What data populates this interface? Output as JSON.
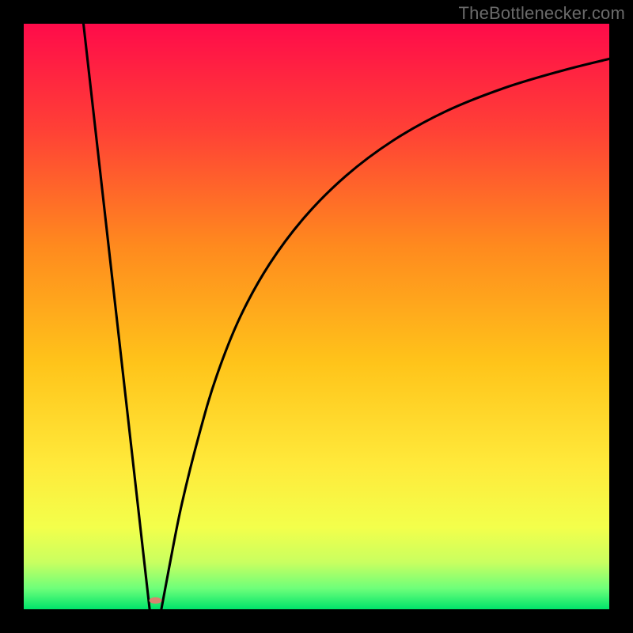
{
  "watermark": "TheBottlenecker.com",
  "chart_data": {
    "type": "line",
    "title": "",
    "xlabel": "",
    "ylabel": "",
    "xlim": [
      0,
      100
    ],
    "ylim": [
      0,
      100
    ],
    "notch_x": 22,
    "marker": {
      "x": 22.5,
      "y": 1.5,
      "rx": 8,
      "ry": 4,
      "fill": "#d8846f"
    },
    "series": [
      {
        "name": "left-branch",
        "points": [
          {
            "x": 10.2,
            "y": 100
          },
          {
            "x": 21.5,
            "y": 0
          }
        ]
      },
      {
        "name": "right-branch",
        "points": [
          {
            "x": 23.5,
            "y": 0
          },
          {
            "x": 25,
            "y": 8
          },
          {
            "x": 27,
            "y": 18
          },
          {
            "x": 30,
            "y": 30
          },
          {
            "x": 33,
            "y": 40
          },
          {
            "x": 37,
            "y": 50
          },
          {
            "x": 42,
            "y": 59
          },
          {
            "x": 48,
            "y": 67
          },
          {
            "x": 55,
            "y": 74
          },
          {
            "x": 63,
            "y": 80
          },
          {
            "x": 72,
            "y": 85
          },
          {
            "x": 82,
            "y": 89
          },
          {
            "x": 92,
            "y": 92
          },
          {
            "x": 100,
            "y": 94
          }
        ]
      }
    ],
    "gradient_stops": [
      {
        "offset": 0,
        "color": "#ff0b4a"
      },
      {
        "offset": 18,
        "color": "#ff4036"
      },
      {
        "offset": 38,
        "color": "#ff8a1e"
      },
      {
        "offset": 58,
        "color": "#ffc41a"
      },
      {
        "offset": 75,
        "color": "#ffe93a"
      },
      {
        "offset": 86,
        "color": "#f3ff4b"
      },
      {
        "offset": 92,
        "color": "#c9ff60"
      },
      {
        "offset": 96.5,
        "color": "#6cff7a"
      },
      {
        "offset": 100,
        "color": "#00e36a"
      }
    ],
    "curve": {
      "stroke": "#000000",
      "width": 3.1
    },
    "background": "#000000"
  }
}
